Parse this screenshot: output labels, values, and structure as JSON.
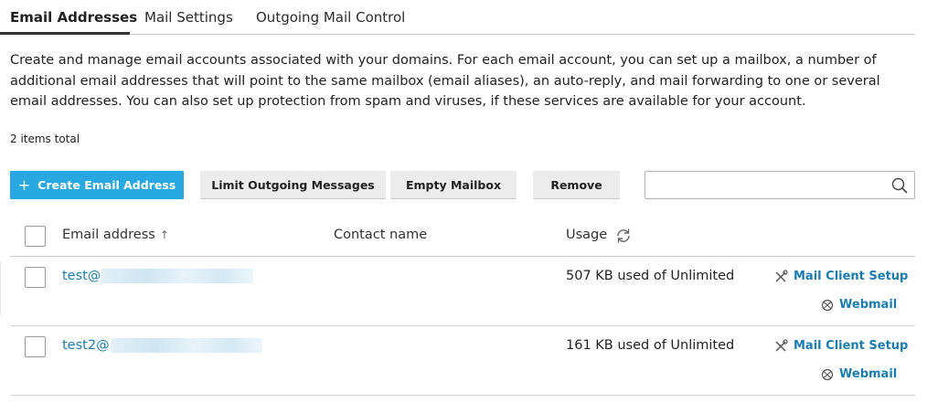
{
  "tabs": [
    {
      "label": "Email Addresses",
      "active": true
    },
    {
      "label": "Mail Settings",
      "active": false
    },
    {
      "label": "Outgoing Mail Control",
      "active": false
    }
  ],
  "description": "Create and manage email accounts associated with your domains. For each email account, you can set up a mailbox, a number of additional email addresses that will point to the same mailbox (email aliases), an auto-reply, and mail forwarding to one or several email addresses. You can also set up protection from spam and viruses, if these services are available for your account.",
  "items_total": "2 items total",
  "toolbar": {
    "create_icon": "+",
    "create_label": "Create Email Address",
    "limit_label": "Limit Outgoing Messages",
    "empty_label": "Empty Mailbox",
    "remove_label": "Remove",
    "search_placeholder": ""
  },
  "table": {
    "columns": {
      "email": "Email address",
      "email_sort": "↑",
      "contact": "Contact name",
      "usage": "Usage"
    },
    "rows": [
      {
        "email": "test@",
        "contact": "",
        "usage": "507 KB used of Unlimited",
        "setup_label": "Mail Client Setup",
        "webmail_label": "Webmail"
      },
      {
        "email": "test2@",
        "contact": "",
        "usage": "161 KB used of Unlimited",
        "setup_label": "Mail Client Setup",
        "webmail_label": "Webmail"
      }
    ]
  },
  "colors": {
    "accent": "#28a8e0",
    "link": "#1a7db2"
  },
  "icons": {
    "search": "search-icon",
    "refresh": "refresh-icon",
    "setup": "tools-icon",
    "webmail": "globe-icon"
  }
}
